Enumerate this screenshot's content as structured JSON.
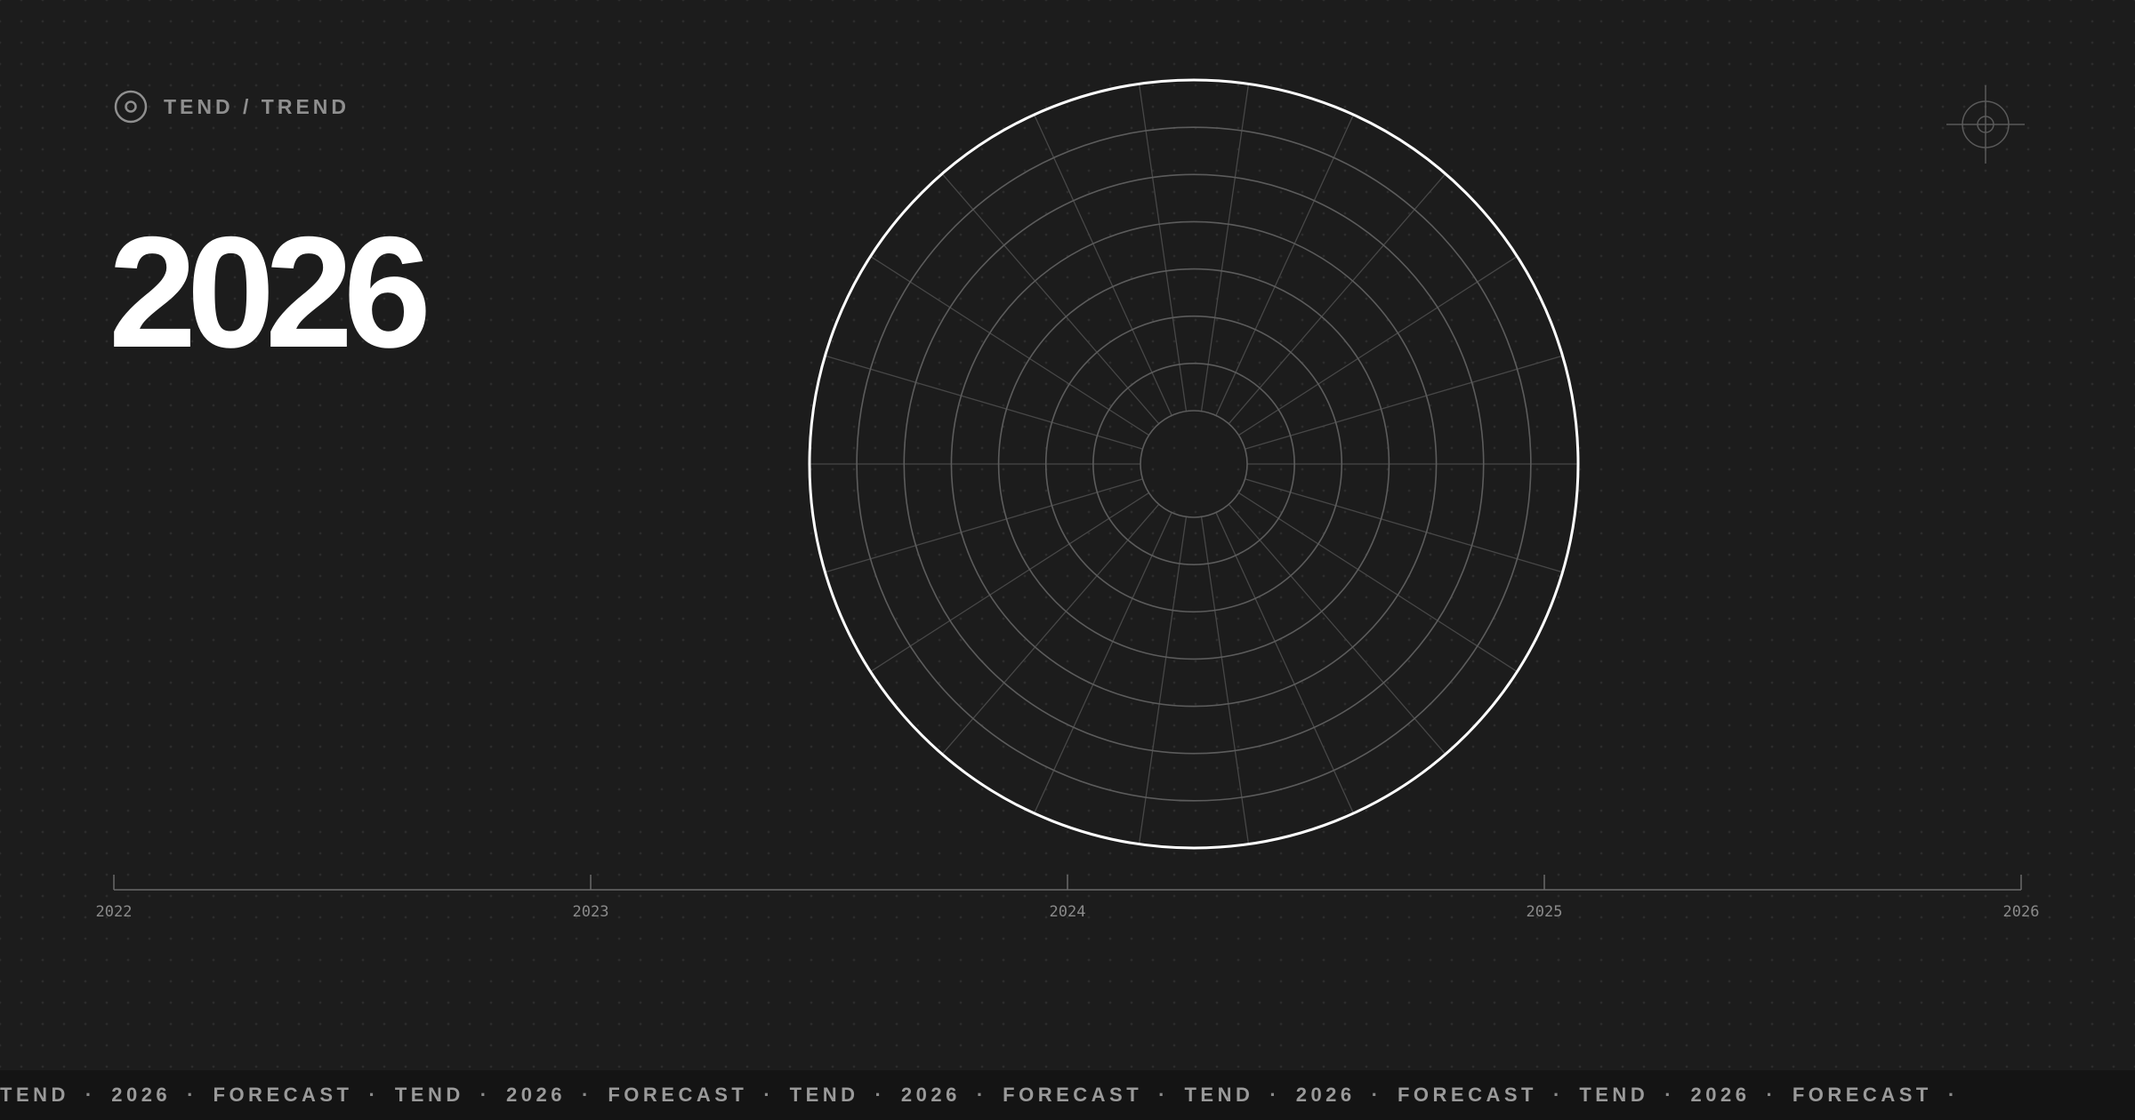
{
  "brand": {
    "text": "TEND / TREND",
    "icon": "target-circle-icon"
  },
  "headline": {
    "year": "2026"
  },
  "crosshair": {
    "icon": "crosshair-icon"
  },
  "radar": {
    "icon": "radar-grid-icon",
    "ring_count": 7,
    "spoke_count": 22
  },
  "timeline": {
    "labels": [
      "2022",
      "2023",
      "2024",
      "2025",
      "2026"
    ]
  },
  "ticker": {
    "items": [
      "TEND",
      "2026",
      "FORECAST",
      "TEND",
      "2026",
      "FORECAST",
      "TEND",
      "2026",
      "FORECAST",
      "TEND",
      "2026",
      "FORECAST",
      "TEND",
      "2026",
      "FORECAST"
    ],
    "separator": "·"
  },
  "colors": {
    "background": "#1c1c1c",
    "ticker_background": "#141414",
    "muted_text": "#8f8f8f",
    "accent": "#ffffff"
  }
}
